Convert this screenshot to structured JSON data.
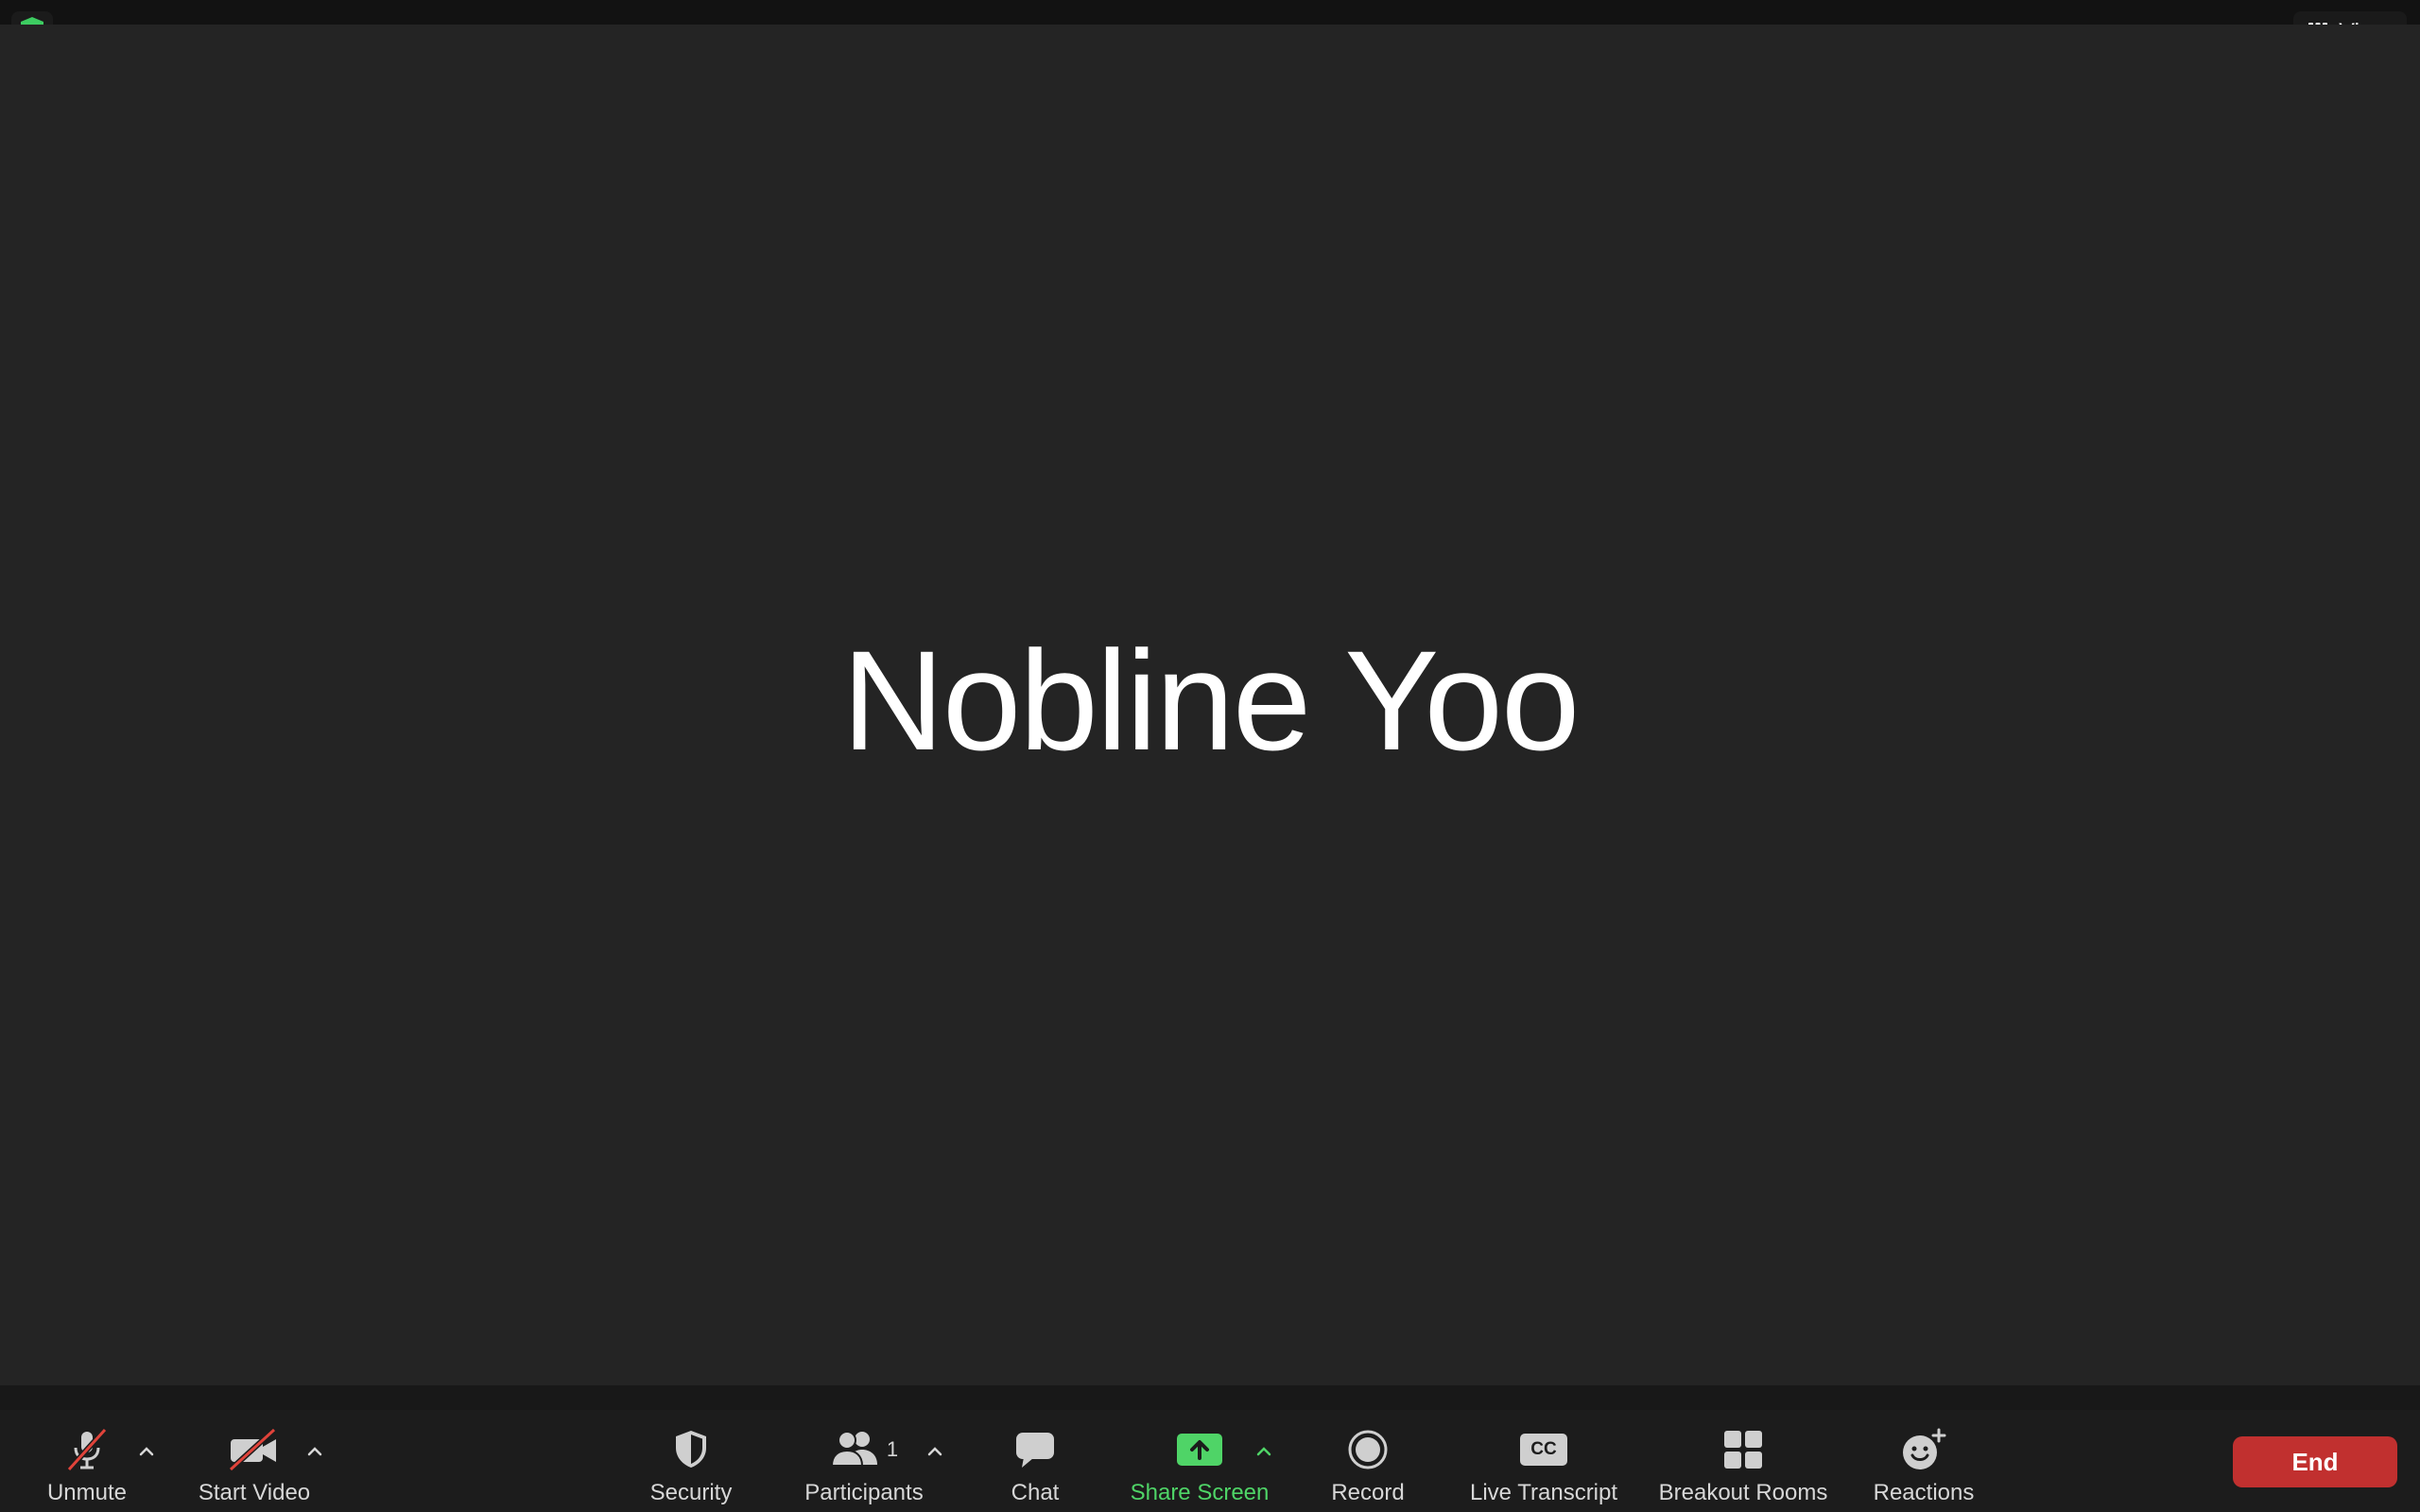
{
  "top_bar": {
    "security_badge_icon": "shield-check-icon",
    "security_badge_color": "#3dcc61",
    "view_label": "View",
    "view_icon": "grid-icon"
  },
  "stage": {
    "participant_name": "Nobline Yoo"
  },
  "toolbar": {
    "unmute_label": "Unmute",
    "unmute_icon": "microphone-muted-icon",
    "start_video_label": "Start Video",
    "start_video_icon": "video-off-icon",
    "security_label": "Security",
    "security_icon": "shield-icon",
    "participants_label": "Participants",
    "participants_count": "1",
    "participants_icon": "people-icon",
    "chat_label": "Chat",
    "chat_icon": "chat-bubble-icon",
    "share_screen_label": "Share Screen",
    "share_screen_icon": "share-arrow-up-icon",
    "share_screen_color": "#4fd467",
    "record_label": "Record",
    "record_icon": "record-icon",
    "live_transcript_label": "Live Transcript",
    "live_transcript_icon_text": "CC",
    "breakout_rooms_label": "Breakout Rooms",
    "breakout_rooms_icon": "grid-four-icon",
    "reactions_label": "Reactions",
    "reactions_icon": "smiley-plus-icon",
    "end_label": "End",
    "end_color": "#c1302f",
    "mute_slash_color": "#e0433a"
  }
}
